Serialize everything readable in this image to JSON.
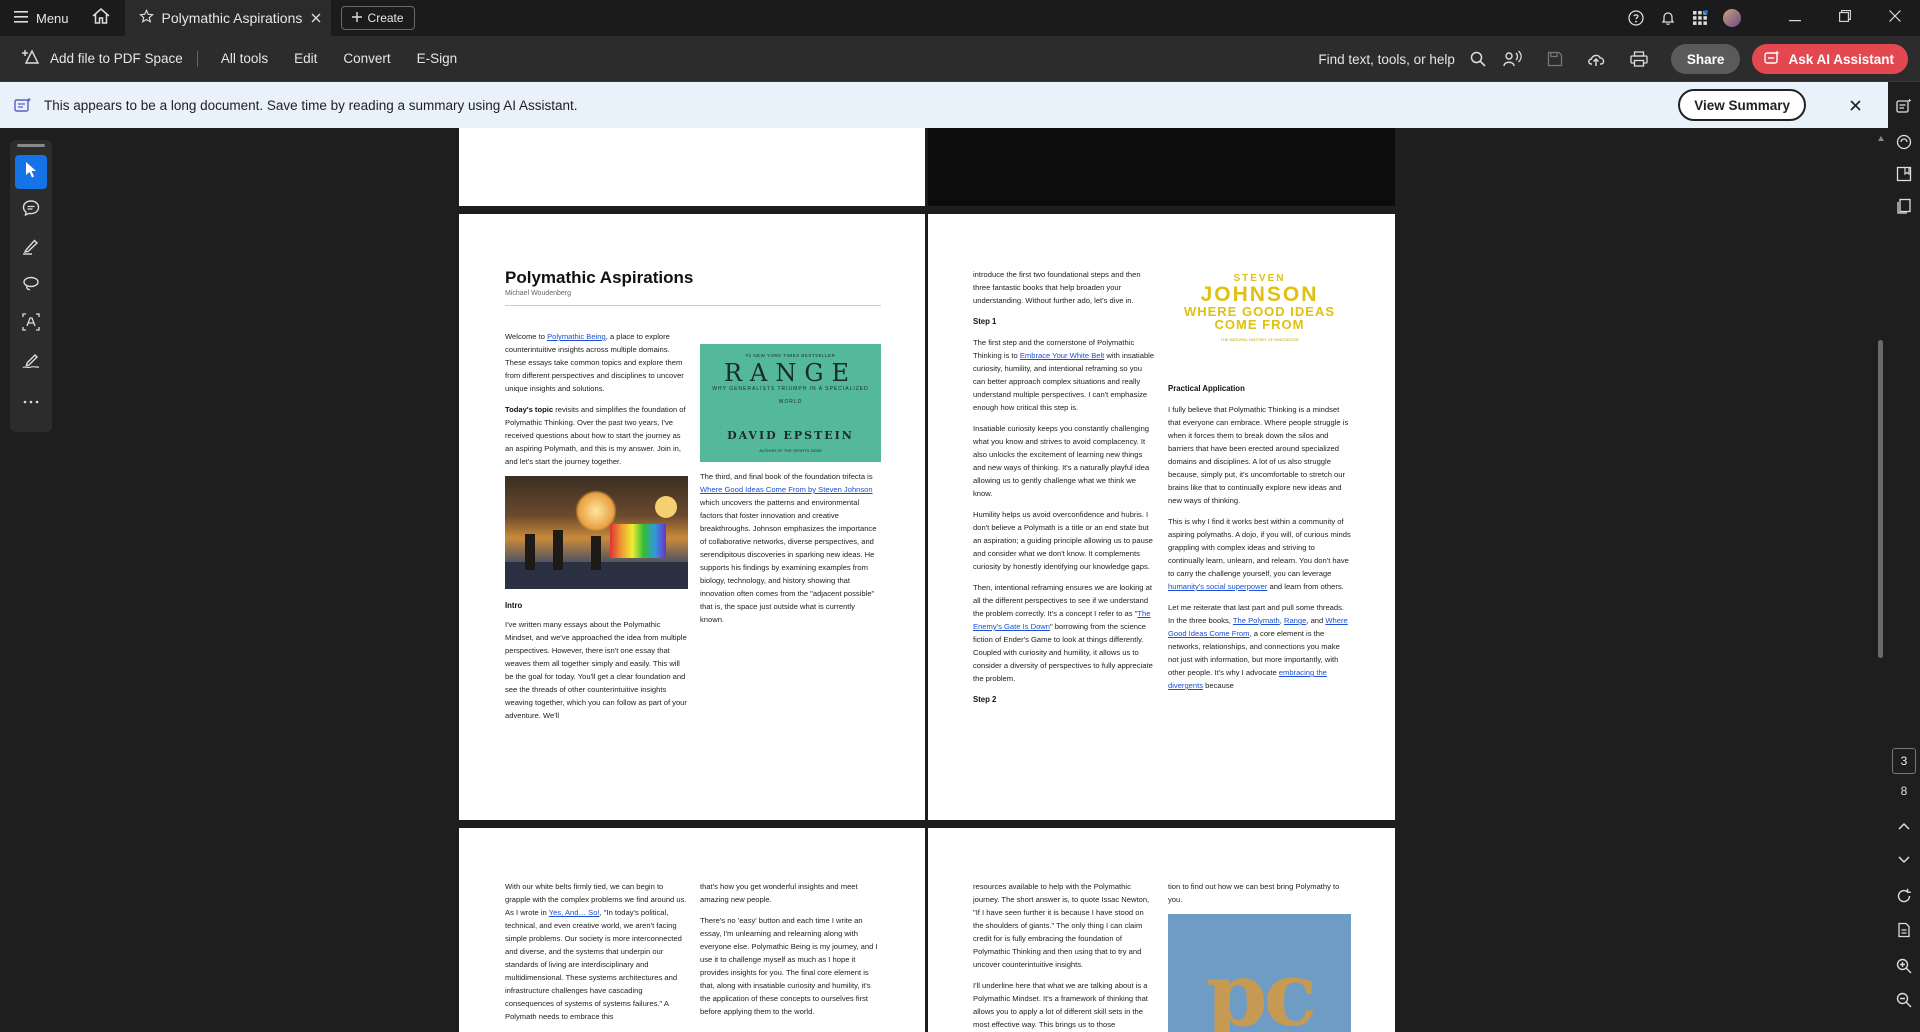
{
  "titlebar": {
    "menu_label": "Menu",
    "tab_title": "Polymathic Aspirations",
    "create_label": "Create"
  },
  "toolbar": {
    "add_file_label": "Add file to PDF Space",
    "all_tools": "All tools",
    "edit": "Edit",
    "convert": "Convert",
    "esign": "E-Sign",
    "find_label": "Find text, tools, or help",
    "share_label": "Share",
    "ask_ai_label": "Ask AI Assistant"
  },
  "banner": {
    "message": "This appears to be a long document. Save time by reading a summary using AI Assistant.",
    "view_summary": "View Summary"
  },
  "page_nav": {
    "current_page": "3",
    "total_pages": "8"
  },
  "colors": {
    "accent_blue": "#1473e6",
    "ai_red": "#e34850",
    "banner_bg": "#e9f1fb",
    "link": "#1a4fd6"
  },
  "doc": {
    "title": "Polymathic Aspirations",
    "author": "Michael Woudenberg",
    "p1_welcome_a": "Welcome to ",
    "p1_welcome_link": "Polymathic Being",
    "p1_welcome_b": ", a place to explore counterintuitive insights across multiple domains. These essays take common topics and explore them from different perspectives and disciplines to uncover unique insights and solutions.",
    "p1_today_bold": "Today's topic",
    "p1_today_rest": " revisits and simplifies the foundation of Polymathic Thinking. Over the past two years, I've received questions about how to start the journey as an aspiring Polymath, and this is my answer. Join in, and let's start the journey together.",
    "intro_heading": "Intro",
    "intro_text": "I've written many essays about the Polymathic Mindset, and we've approached the idea from multiple perspectives. However, there isn't one essay that weaves them all together simply and easily. This will be the goal for today. You'll get a clear foundation and see the threads of other counterintuitive insights weaving together, which you can follow as part of your adventure. We'll",
    "range_top": "#1 NEW YORK TIMES BESTSELLER",
    "range_title": "RANGE",
    "range_sub": "WHY GENERALISTS TRIUMPH IN A SPECIALIZED WORLD",
    "range_author": "DAVID EPSTEIN",
    "range_bottom": "AUTHOR OF THE SPORTS GENE",
    "third_book_a": "The third, and final book of the foundation trifecta is ",
    "third_book_link": "Where Good Ideas Come From by Steven Johnson",
    "third_book_b": " which uncovers the patterns and environmental factors that foster innovation and creative breakthroughs. Johnson emphasizes the importance of collaborative networks, diverse perspectives, and serendipitous discoveries in sparking new ideas. He supports his findings by examining examples from biology, technology, and history showing that innovation often comes from the \"adjacent possible\" that is, the space just outside what is currently known.",
    "p2_intro": "introduce the first two foundational steps and then three fantastic books that help broaden your understanding. Without further ado, let's dive in.",
    "step1": "Step 1",
    "step1_a": "The first step and the cornerstone of Polymathic Thinking is to ",
    "step1_link": "Embrace Your White Belt",
    "step1_b": " with insatiable curiosity, humility, and intentional reframing so you can better approach complex situations and really understand multiple perspectives. I can't emphasize enough how critical this step is.",
    "curiosity_text": "Insatiable curiosity keeps you constantly challenging what you know and strives to avoid complacency. It also unlocks the excitement of learning new things and new ways of thinking. It's a naturally playful idea allowing us to gently challenge what we think we know.",
    "humility_text": "Humility helps us avoid overconfidence and hubris. I don't believe a Polymath is a title or an end state but an aspiration; a guiding principle allowing us to pause and consider what we don't know. It complements curiosity by honestly identifying our knowledge gaps.",
    "reframe_a": "Then, intentional reframing ensures we are looking at all the different perspectives to see if we understand the problem correctly. It's a concept I refer to as \"",
    "reframe_link": "The Enemy's Gate Is Down",
    "reframe_b": "\" borrowing from the science fiction of Ender's Game to look at things differently. Coupled with curiosity and humility, it allows us to consider a diversity of perspectives to fully appreciate the problem.",
    "step2": "Step 2",
    "johnson_1": "STEVEN",
    "johnson_2": "JOHNSON",
    "johnson_3": "WHERE GOOD IDEAS COME FROM",
    "johnson_4": "THE NATURAL HISTORY OF INNOVATION",
    "practical_heading": "Practical Application",
    "practical_text": "I fully believe that Polymathic Thinking is a mindset that everyone can embrace. Where people struggle is when it forces them to break down the silos and barriers that have been erected around specialized domains and disciplines. A lot of us also struggle because, simply put, it's uncomfortable to stretch our brains like that to continually explore new ideas and new ways of thinking.",
    "dojo_a": "This is why I find it works best within a community of aspiring polymaths. A dojo, if you will, of curious minds grappling with complex ideas and striving to continually learn, unlearn, and relearn. You don't have to carry the challenge yourself, you can leverage ",
    "dojo_link": "humanity's social superpower",
    "dojo_b": " and learn from others.",
    "reiterate_a": "Let me reiterate that last part and pull some threads. In the three books, ",
    "reiterate_link1": "The Polymath",
    "reiterate_sep1": ", ",
    "reiterate_link2": "Range",
    "reiterate_sep2": ", and ",
    "reiterate_link3": "Where Good Ideas Come From",
    "reiterate_b": ", a core element is the networks, relationships, and connections you make not just with information, but more importantly, with other people. It's why I advocate ",
    "reiterate_link4": "embracing the divergents",
    "reiterate_c": " because",
    "p3_a": "With our white belts firmly tied, we can begin to grapple with the complex problems we find around us. As I wrote in ",
    "p3_link": "Yes, And… So!",
    "p3_b": ", \"In today's political, technical, and even creative world, we aren't facing simple problems. Our society is more interconnected and diverse, and the systems that underpin our standards of living are interdisciplinary and multidimensional. These systems architectures and infrastructure challenges have cascading consequences of systems of systems failures.\" A Polymath needs to embrace this",
    "p3_col2_a": "that's how you get wonderful insights and meet amazing new people.",
    "p3_col2_b": "There's no 'easy' button and each time I write an essay, I'm unlearning and relearning along with everyone else. Polymathic Being is my journey, and I use it to challenge myself as much as I hope it provides insights for you. The final core element is that, along with insatiable curiosity and humility, it's the application of these concepts to ourselves first before applying them to the world.",
    "p4_a": "resources available to help with the Polymathic journey. The short answer is, to quote Issac Newton, \"If I have seen further it is because I have stood on the shoulders of giants.\" The only thing I can claim credit for is fully embracing the foundation of Polymathic Thinking and then using that to try and uncover counterintuitive insights.",
    "p4_b": "I'll underline here that what we are talking about is a Polymathic Mindset. It's a framework of thinking that allows you to apply a lot of different skill sets in the most effective way. This brings us to those",
    "p4_col2": "tion to find out how we can best bring Polymathy to you.",
    "pc_logo_text": "pc"
  }
}
